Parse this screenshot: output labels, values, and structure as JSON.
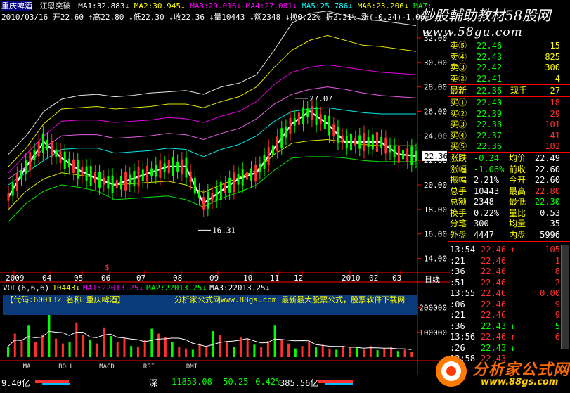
{
  "stock": {
    "name": "重庆啤酒",
    "indicator": "江恩突破",
    "ma_line": [
      {
        "text": "MA1:32.883",
        "arrow": "↓",
        "color": "#ffffff"
      },
      {
        "text": "MA2:30.945",
        "arrow": "↓",
        "color": "#ffff00"
      },
      {
        "text": "MA3:29.016",
        "arrow": "↓",
        "color": "#ff00ff"
      },
      {
        "text": "MA4:27.081",
        "arrow": "↓",
        "color": "#ff00ff"
      },
      {
        "text": "MA5:25.786",
        "arrow": "↓",
        "color": "#00ffff"
      },
      {
        "text": "MA6:23.206",
        "arrow": "↓",
        "color": "#ffff00"
      },
      {
        "text": "MA7:",
        "arrow": "",
        "color": "#00ff00"
      }
    ],
    "info_line": "2010/03/16 开22.60 ↑高22.80 ↓低22.30 ↓收22.36 ↓量10443 ↓额2348 ↓换0.22% 振2.21% 涨(-0.24)-1.06% ↓"
  },
  "watermark": {
    "title": "炒股輔助教材58股网",
    "url": "www.58gu.com"
  },
  "chart_data": [
    {
      "type": "line",
      "title": "",
      "y_ticks": [
        "32.00",
        "30.00",
        "28.00",
        "26.00",
        "24.00",
        "22.00",
        "20.00",
        "18.00",
        "16.00",
        "14.00"
      ],
      "ylim": [
        13.0,
        33.2
      ],
      "x_ticks": [
        "2009",
        "04",
        "05",
        "06",
        "07",
        "08",
        "09",
        "10",
        "11",
        "12",
        "2010",
        "02",
        "03"
      ],
      "x_unit_label": "日线",
      "current_price_label": "22.36",
      "annotations": [
        {
          "text": "27.07",
          "value": 27.07
        },
        {
          "text": "16.31",
          "value": 16.31
        }
      ],
      "signal_marker": "$",
      "series": [
        {
          "name": "MA1",
          "color": "#ffffff",
          "values": [
            22.5,
            24,
            26,
            27,
            27.3,
            27.4,
            27.2,
            27.3,
            27.5,
            27.6,
            27.7,
            27.4,
            28,
            28.3,
            29,
            31,
            33.2,
            34,
            34.2,
            33.8,
            33.5,
            33.4,
            33.2,
            33
          ]
        },
        {
          "name": "MA2",
          "color": "#ffff00",
          "values": [
            21.5,
            23,
            25,
            26.2,
            26.3,
            26.4,
            26.2,
            26.3,
            26.4,
            26.6,
            26.6,
            26.3,
            26.8,
            27.2,
            28,
            29.6,
            31,
            31.8,
            32.2,
            31.8,
            31.4,
            31.3,
            31.1,
            30.9
          ]
        },
        {
          "name": "MA3",
          "color": "#ff00ff",
          "values": [
            21,
            22.5,
            24,
            25.2,
            25.3,
            25.3,
            25.1,
            25.2,
            25.3,
            25.5,
            25.4,
            25.1,
            25.6,
            26,
            26.8,
            28.2,
            29.2,
            29.6,
            29.8,
            29.6,
            29.4,
            29.2,
            29.1,
            29
          ]
        },
        {
          "name": "MA4",
          "color": "#ff66ff",
          "values": [
            20.5,
            21.5,
            23,
            24,
            24.1,
            24.1,
            23.8,
            23.9,
            24,
            24.2,
            24.1,
            23.7,
            24.2,
            24.6,
            25.4,
            26.6,
            27.4,
            27.8,
            28,
            27.8,
            27.5,
            27.3,
            27.2,
            27.1
          ]
        },
        {
          "name": "MA5",
          "color": "#00ffff",
          "values": [
            20,
            21,
            22,
            22.9,
            23,
            23,
            22.6,
            22.7,
            22.8,
            23,
            22.9,
            22.3,
            22.9,
            23.3,
            24,
            25.2,
            26,
            26.2,
            26.3,
            26.1,
            25.9,
            25.8,
            25.8,
            25.8
          ]
        },
        {
          "name": "MA6",
          "color": "#ffff00",
          "values": [
            18,
            19.5,
            20.5,
            21,
            20.8,
            20.6,
            20,
            20.1,
            20.2,
            20.3,
            20,
            19.4,
            20,
            20.6,
            21.2,
            22.5,
            23.4,
            23.6,
            23.7,
            23.5,
            23.3,
            23.2,
            23.2,
            23.2
          ]
        },
        {
          "name": "MA7",
          "color": "#00ff00",
          "values": [
            17,
            18.5,
            19.5,
            20,
            19.8,
            19.5,
            18.8,
            18.9,
            19,
            19.1,
            18.8,
            18.2,
            18.9,
            19.4,
            20,
            21.2,
            22.2,
            22.3,
            22.3,
            22.2,
            22,
            21.9,
            21.9,
            21.9
          ]
        },
        {
          "name": "Price",
          "color": "#ffffff",
          "values": [
            19,
            21.5,
            23.5,
            22.2,
            21.2,
            20.5,
            20,
            20.5,
            21,
            21.5,
            21.5,
            18.5,
            19.5,
            20.5,
            21,
            23,
            25,
            26,
            25,
            23.5,
            23.5,
            23.5,
            22.5,
            22.36
          ]
        }
      ]
    },
    {
      "type": "bar",
      "title": "",
      "legend_items": [
        {
          "text": "VOL(6,6,6)",
          "color": "#ffffff"
        },
        {
          "text": "10443↓",
          "color": "#ffff00"
        },
        {
          "text": "MA1:22013.25↓",
          "color": "#ff00ff"
        },
        {
          "text": "MA2:22013.25↓",
          "color": "#00ff00"
        },
        {
          "text": "MA3:22013.25↓",
          "color": "#ffffff"
        }
      ],
      "y_ticks": [
        "200000",
        "100000"
      ],
      "ylim": [
        0,
        250000
      ],
      "values": [
        42000,
        95000,
        65000,
        130000,
        60000,
        90000,
        185000,
        75000,
        55000,
        60000,
        140000,
        90000,
        70000,
        55000,
        120000,
        85000,
        60000,
        75000,
        45000,
        40000,
        70000,
        115000,
        95000,
        80000,
        60000,
        40000,
        35000,
        30000,
        55000,
        40000,
        105000,
        90000,
        60000,
        40000,
        80000,
        75000,
        50000,
        40000,
        65000,
        130000,
        70000,
        55000,
        35000,
        45000,
        60000,
        40000,
        50000,
        35000,
        30000,
        45000,
        38000,
        40000,
        30000,
        45000,
        28000,
        35000,
        40000,
        25000,
        30000,
        22000
      ]
    }
  ],
  "formula_bar": {
    "code_text": "【代码:600132 名称:重庆啤酒】",
    "scroll_text": "分析家公式网www.88gs.com 最新最大股票公式，股票软件下载网"
  },
  "tabs": [
    "MA",
    "BOLL",
    "MACD",
    "RSI",
    "DMI"
  ],
  "order_book": {
    "asks": [
      {
        "label": "卖⑤",
        "price": "22.46",
        "volume": "15"
      },
      {
        "label": "卖④",
        "price": "22.43",
        "volume": "825"
      },
      {
        "label": "卖③",
        "price": "22.42",
        "volume": "300"
      },
      {
        "label": "卖②",
        "price": "22.41",
        "volume": "4"
      }
    ],
    "latest": {
      "label": "最新",
      "price": "22.36",
      "hand_label": "现手",
      "hand": "27"
    },
    "bids": [
      {
        "label": "买①",
        "price": "22.40",
        "volume": "18"
      },
      {
        "label": "买②",
        "price": "22.39",
        "volume": "29"
      },
      {
        "label": "买③",
        "price": "22.38",
        "volume": "101"
      },
      {
        "label": "买④",
        "price": "22.37",
        "volume": "41"
      },
      {
        "label": "买⑤",
        "price": "22.36",
        "volume": "102"
      }
    ]
  },
  "stats": [
    {
      "l1": "涨跌",
      "v1": "-0.24",
      "l2": "均价",
      "v2": "22.49"
    },
    {
      "l1": "涨幅",
      "v1": "-1.06%",
      "l2": "前收",
      "v2": "22.60"
    },
    {
      "l1": "振幅",
      "v1": "2.21%",
      "l2": "今开",
      "v2": "22.60"
    },
    {
      "l1": "总手",
      "v1": "10443",
      "l2": "最高",
      "v2": "22.80"
    },
    {
      "l1": "总额",
      "v1": "2348",
      "l2": "最低",
      "v2": "22.30"
    },
    {
      "l1": "换手",
      "v1": "0.22%",
      "l2": "量比",
      "v2": "0.53"
    },
    {
      "l1": "分笔",
      "v1": "300",
      "l2": "均量",
      "v2": "35"
    },
    {
      "l1": "外盘",
      "v1": "4447",
      "l2": "内盘",
      "v2": "5996"
    }
  ],
  "ticks": [
    {
      "time": "13:54",
      "price": "22.46",
      "arrow": "↑",
      "vol": "105",
      "dir": "up"
    },
    {
      "time": ":21",
      "price": "22.46",
      "arrow": "",
      "vol": "1",
      "dir": "up"
    },
    {
      "time": ":36",
      "price": "22.46",
      "arrow": "",
      "vol": "8",
      "dir": "up"
    },
    {
      "time": ":51",
      "price": "22.46",
      "arrow": "",
      "vol": "2",
      "dir": "up"
    },
    {
      "time": "13:55",
      "price": "22.46",
      "arrow": "",
      "vol": "0.00",
      "dir": "flat"
    },
    {
      "time": ":06",
      "price": "22.46",
      "arrow": "",
      "vol": "9",
      "dir": "flat"
    },
    {
      "time": ":21",
      "price": "22.46",
      "arrow": "",
      "vol": "9",
      "dir": "flat"
    },
    {
      "time": ":36",
      "price": "22.43",
      "arrow": "↓",
      "vol": "5",
      "dir": "down"
    },
    {
      "time": "13:56",
      "price": "22.46",
      "arrow": "↑",
      "vol": "6",
      "dir": "up"
    },
    {
      "time": ":26",
      "price": "22.43",
      "arrow": "↓",
      "vol": "",
      "dir": "down"
    },
    {
      "time": "13:58",
      "price": "22.43",
      "arrow": "",
      "vol": "",
      "dir": "flat"
    }
  ],
  "status_bar": {
    "left_value": "9.40亿",
    "index_name": "深",
    "index_value": "11853.08",
    "change": "-50.25",
    "pct": "-0.42%",
    "amount": "385.56亿"
  },
  "logo": {
    "text": "分析家公式网",
    "url": "www.88gs.com"
  },
  "colors": {
    "up": "#ff3333",
    "down": "#00ff00",
    "axis": "#ff0000",
    "panel_bg": "#000000",
    "formula_bg": "#0a3a7a"
  }
}
